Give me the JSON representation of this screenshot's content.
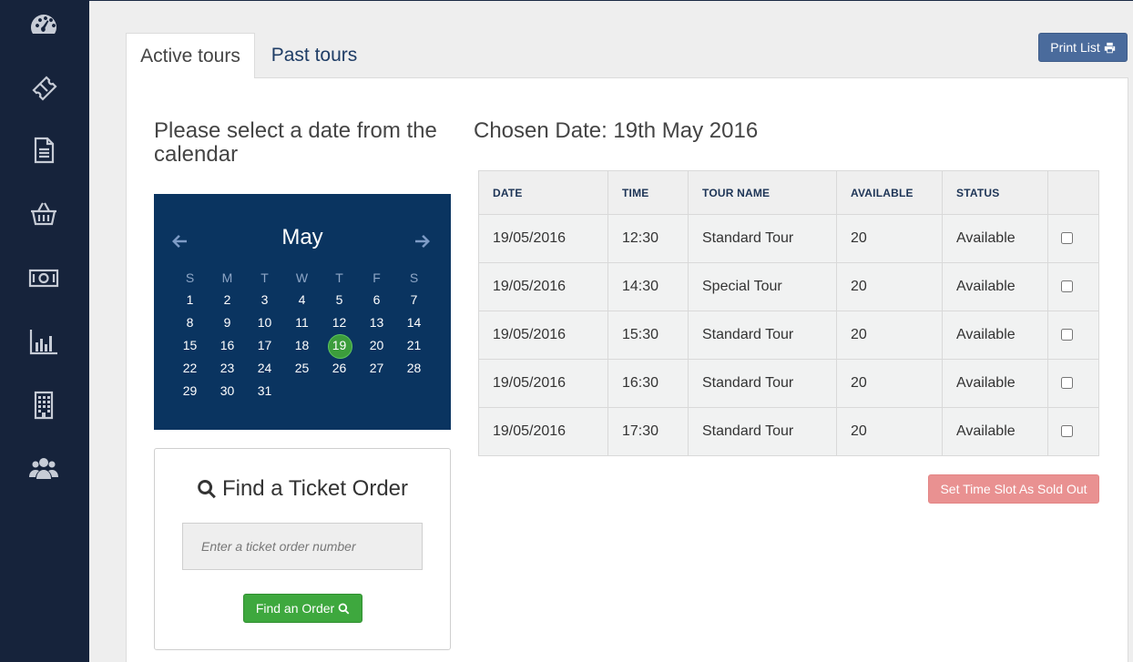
{
  "sidebar": {
    "items": [
      {
        "icon": "dashboard-icon"
      },
      {
        "icon": "ticket-icon"
      },
      {
        "icon": "document-icon"
      },
      {
        "icon": "basket-icon"
      },
      {
        "icon": "money-icon"
      },
      {
        "icon": "bar-chart-icon"
      },
      {
        "icon": "building-icon"
      },
      {
        "icon": "users-icon"
      }
    ],
    "background": "#16233b"
  },
  "tabs": [
    {
      "label": "Active tours",
      "active": true
    },
    {
      "label": "Past tours",
      "active": false
    }
  ],
  "toolbar": {
    "print_label": "Print List"
  },
  "calendar_section": {
    "heading": "Please select a date from the calendar",
    "month": "May",
    "weekdays": [
      "S",
      "M",
      "T",
      "W",
      "T",
      "F",
      "S"
    ],
    "days": [
      "1",
      "2",
      "3",
      "4",
      "5",
      "6",
      "7",
      "8",
      "9",
      "10",
      "11",
      "12",
      "13",
      "14",
      "15",
      "16",
      "17",
      "18",
      "19",
      "20",
      "21",
      "22",
      "23",
      "24",
      "25",
      "26",
      "27",
      "28",
      "29",
      "30",
      "31"
    ],
    "selected_day": "19",
    "background": "#0a3460",
    "selected_color": "#3c9d3c"
  },
  "find_order": {
    "title": "Find a Ticket Order",
    "placeholder": "Enter a ticket order number",
    "value": "",
    "button_label": "Find an Order"
  },
  "schedule": {
    "chosen_date_label": "Chosen Date: 19th May 2016",
    "columns": [
      "DATE",
      "TIME",
      "TOUR NAME",
      "AVAILABLE",
      "STATUS",
      ""
    ],
    "rows": [
      {
        "date": "19/05/2016",
        "time": "12:30",
        "tour_name": "Standard Tour",
        "available": "20",
        "status": "Available",
        "checked": false
      },
      {
        "date": "19/05/2016",
        "time": "14:30",
        "tour_name": "Special Tour",
        "available": "20",
        "status": "Available",
        "checked": false
      },
      {
        "date": "19/05/2016",
        "time": "15:30",
        "tour_name": "Standard Tour",
        "available": "20",
        "status": "Available",
        "checked": false
      },
      {
        "date": "19/05/2016",
        "time": "16:30",
        "tour_name": "Standard Tour",
        "available": "20",
        "status": "Available",
        "checked": false
      },
      {
        "date": "19/05/2016",
        "time": "17:30",
        "tour_name": "Standard Tour",
        "available": "20",
        "status": "Available",
        "checked": false
      }
    ],
    "sold_out_label": "Set Time Slot As Sold Out"
  },
  "colors": {
    "print_button": "#4a6b9c",
    "find_button": "#3ea83e",
    "sold_out_button": "#e99191"
  }
}
